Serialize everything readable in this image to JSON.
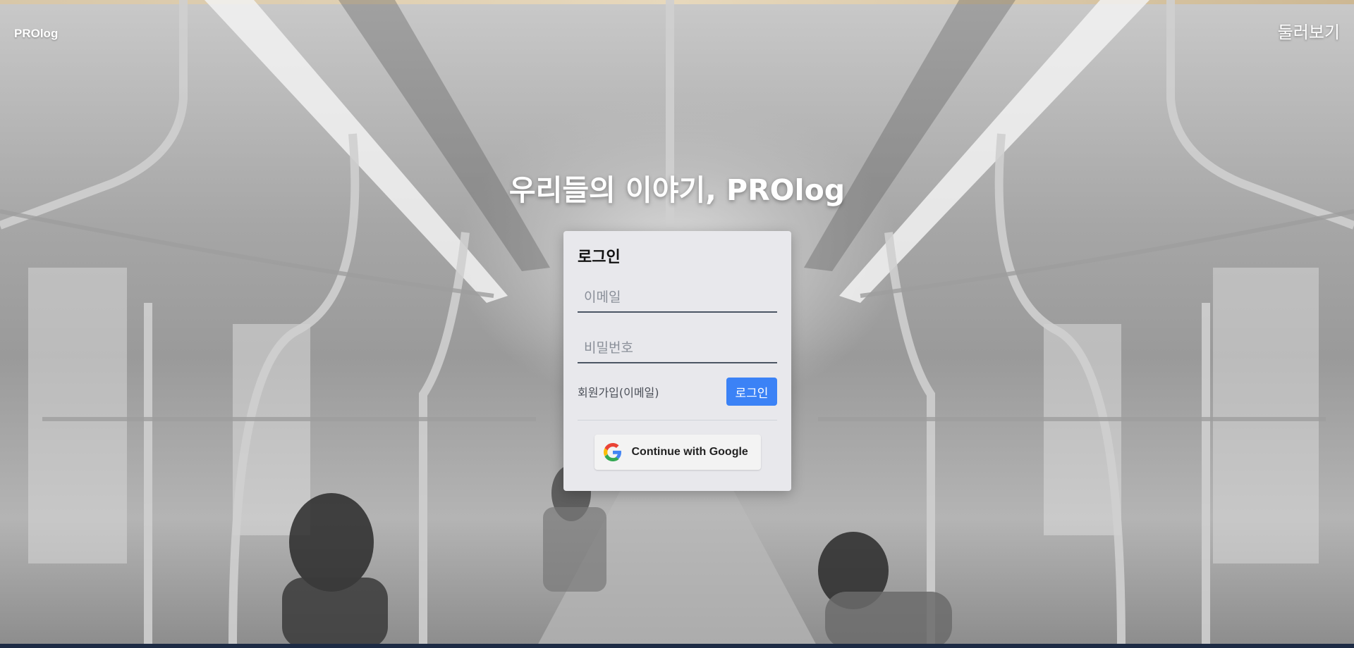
{
  "header": {
    "brand": "PROlog",
    "browse_label": "둘러보기"
  },
  "hero": {
    "headline": "우리들의 이야기, PROlog"
  },
  "login_card": {
    "title": "로그인",
    "email_placeholder": "이메일",
    "password_placeholder": "비밀번호",
    "signup_link": "회원가입(이메일)",
    "login_button": "로그인",
    "google_button": "Continue with Google"
  },
  "colors": {
    "primary": "#3b82f6",
    "card_background": "#e8e8ec"
  }
}
